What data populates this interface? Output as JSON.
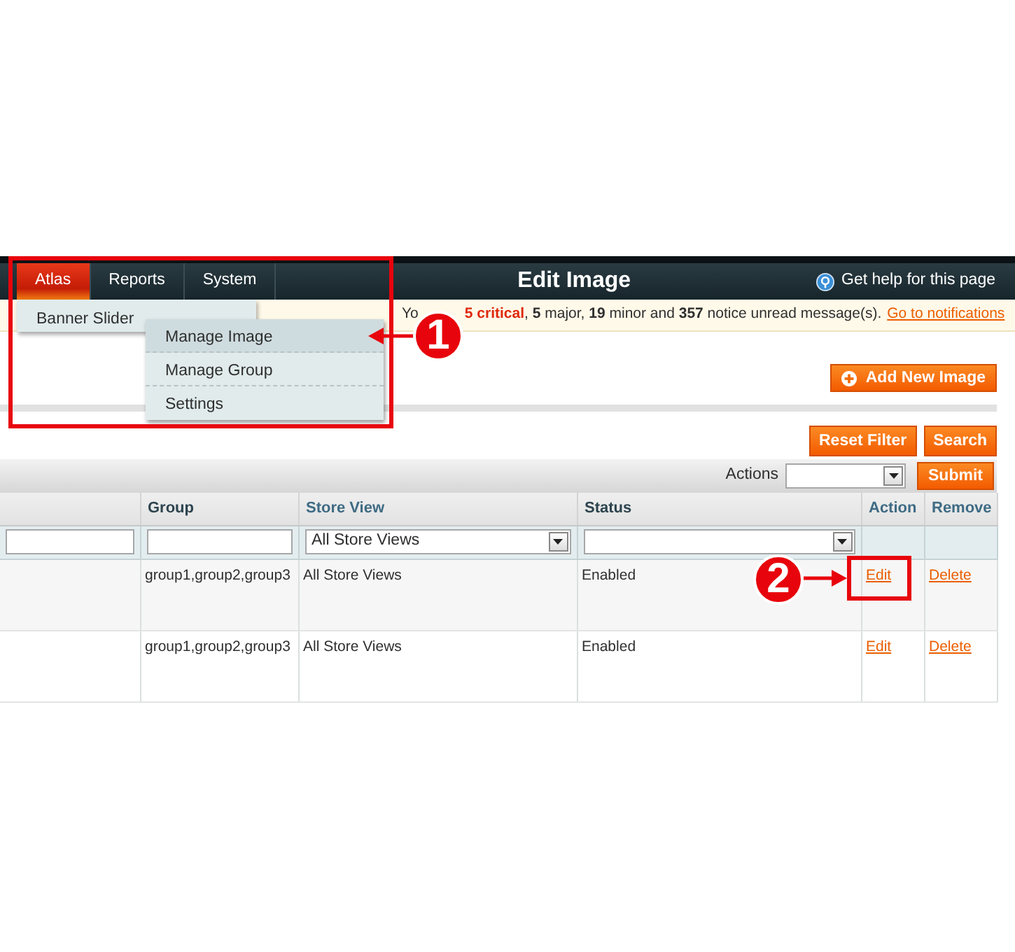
{
  "header": {
    "tabs": [
      {
        "label": "Atlas",
        "selected": true
      },
      {
        "label": "Reports",
        "selected": false
      },
      {
        "label": "System",
        "selected": false
      }
    ],
    "title": "Edit Image",
    "help": "Get help for this page"
  },
  "menu": {
    "items": [
      {
        "label": "Banner Slider"
      }
    ]
  },
  "submenu": {
    "items": [
      {
        "label": "Manage Image",
        "selected": true
      },
      {
        "label": "Manage Group",
        "selected": false
      },
      {
        "label": "Settings",
        "selected": false
      }
    ]
  },
  "notice": {
    "lead": "Yo",
    "critical": "5 critical",
    "text": ", **5** major, **19** minor and **357** notice unread message(s).",
    "link": "Go to notifications"
  },
  "add_button": "Add New Image",
  "filter_buttons": [
    "Reset Filter",
    "Search"
  ],
  "massaction": {
    "label": "Actions",
    "submit": "Submit"
  },
  "table": {
    "columns": [
      {
        "label": "Group",
        "sortable": false
      },
      {
        "label": "Store View",
        "sortable": true
      },
      {
        "label": "Status",
        "sortable": false
      },
      {
        "label": "Action",
        "sortable": true
      },
      {
        "label": "Remove",
        "sortable": true
      }
    ],
    "filters": {
      "store_view": "All Store Views"
    },
    "rows": [
      {
        "group": "group1,group2,group3",
        "store_view": "All Store Views",
        "status": "Enabled",
        "action": "Edit",
        "remove": "Delete"
      },
      {
        "group": "group1,group2,group3",
        "store_view": "All Store Views",
        "status": "Enabled",
        "action": "Edit",
        "remove": "Delete"
      }
    ]
  },
  "callouts": [
    {
      "label": "1"
    },
    {
      "label": "2"
    }
  ]
}
